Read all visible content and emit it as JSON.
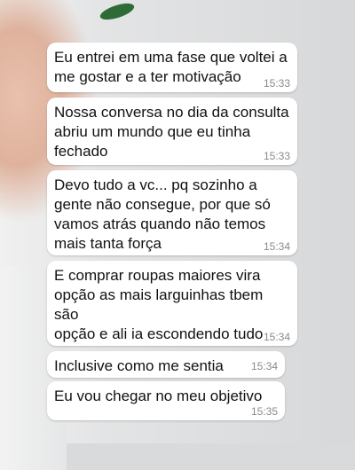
{
  "messages": [
    {
      "text": "Eu entrei em uma fase que voltei a\nme gostar e a ter motivação",
      "time": "15:33"
    },
    {
      "text": "Nossa conversa no dia da consulta\nabriu um mundo que eu tinha\nfechado",
      "time": "15:33"
    },
    {
      "text": "Devo tudo a vc... pq sozinho a\ngente não consegue, por que só\nvamos atrás quando não temos\nmais tanta força",
      "time": "15:34"
    },
    {
      "text": "E comprar roupas maiores vira\nopção as mais larguinhas tbem são\nopção e ali ia escondendo tudo",
      "time": "15:34"
    },
    {
      "text": "Inclusive como me sentia",
      "time": "15:34"
    },
    {
      "text": "Eu vou chegar no meu objetivo",
      "time": "15:35"
    }
  ]
}
